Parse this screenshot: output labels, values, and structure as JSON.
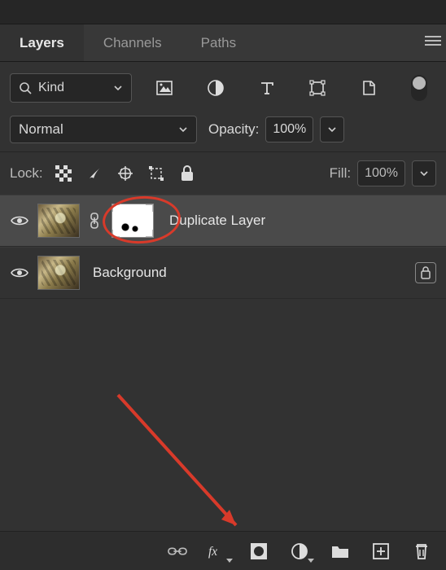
{
  "tabs": {
    "layers": "Layers",
    "channels": "Channels",
    "paths": "Paths"
  },
  "filter": {
    "kind_label": "Kind"
  },
  "blend": {
    "mode": "Normal",
    "opacity_label": "Opacity:",
    "opacity_value": "100%"
  },
  "lock": {
    "label": "Lock:",
    "fill_label": "Fill:",
    "fill_value": "100%"
  },
  "layers": {
    "items": [
      {
        "name": "Duplicate Layer"
      },
      {
        "name": "Background"
      }
    ]
  }
}
